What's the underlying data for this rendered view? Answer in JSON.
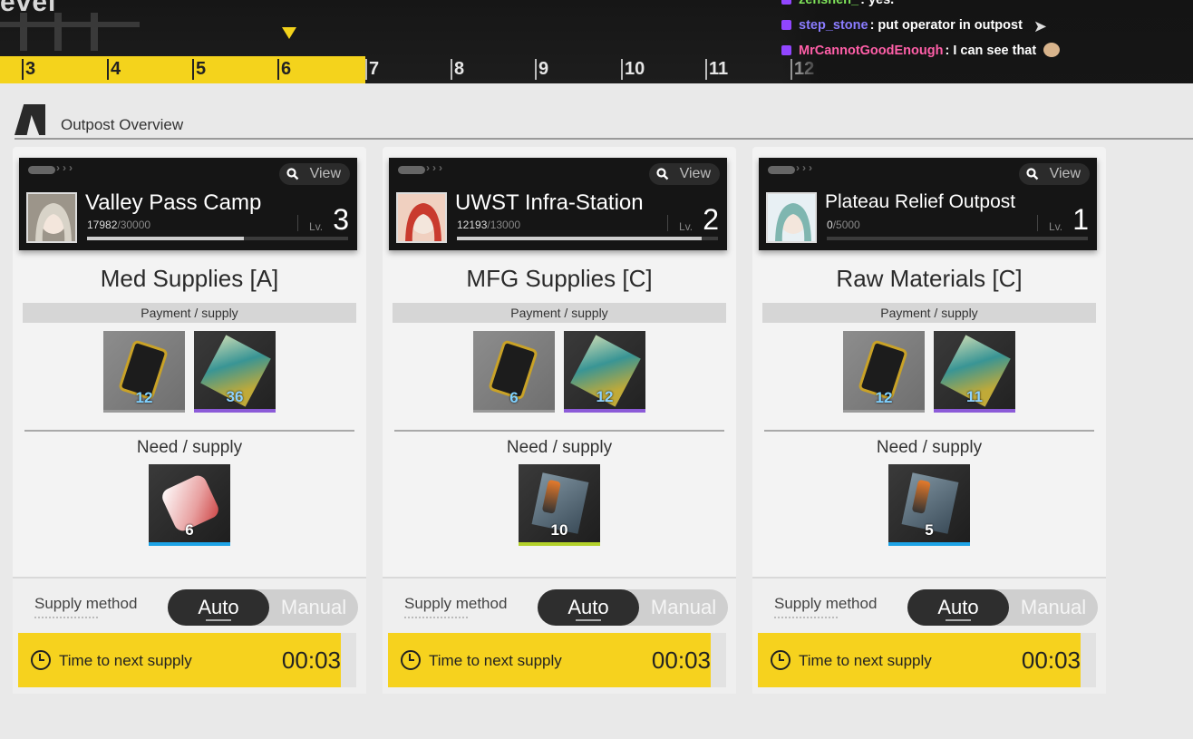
{
  "top": {
    "logo_text": "evel",
    "timeline": [
      {
        "num": "3",
        "done": true
      },
      {
        "num": "4",
        "done": true
      },
      {
        "num": "5",
        "done": true
      },
      {
        "num": "6",
        "done": true
      },
      {
        "num": "7",
        "done": false
      },
      {
        "num": "8",
        "done": false
      },
      {
        "num": "9",
        "done": false
      },
      {
        "num": "10",
        "done": false
      },
      {
        "num": "11",
        "done": false
      },
      {
        "num": "12",
        "done": false
      }
    ],
    "timeline_progress": 0.306
  },
  "chat": [
    {
      "user": "zenshen_",
      "message": ": yes.",
      "user_color": "#7fe35a"
    },
    {
      "user": "step_stone",
      "message": ": put operator in outpost",
      "user_color": "#8a7cff"
    },
    {
      "user": "MrCannotGoodEnough",
      "message": ": I can see that",
      "user_color": "#ff5fa8"
    }
  ],
  "section": {
    "title": "Outpost Overview"
  },
  "common": {
    "view_label": "View",
    "lv_label": "Lv.",
    "payment_label": "Payment / supply",
    "need_label": "Need / supply",
    "supply_method_label": "Supply method",
    "auto_label": "Auto",
    "manual_label": "Manual",
    "timer_label": "Time to next supply"
  },
  "outposts": [
    {
      "name": "Valley Pass Camp",
      "progress_current": "17982",
      "progress_max": "/30000",
      "progress_fraction": 0.599,
      "level": "3",
      "supply_type": "Med Supplies [A]",
      "payment": [
        {
          "qty": "12",
          "icon": "phone-icon"
        },
        {
          "qty": "36",
          "icon": "chip-icon"
        }
      ],
      "need": [
        {
          "qty": "6",
          "icon": "medpack-icon"
        }
      ],
      "timer": "00:03",
      "timer_fraction": 0.955
    },
    {
      "name": "UWST Infra-Station",
      "progress_current": "12193",
      "progress_max": "/13000",
      "progress_fraction": 0.938,
      "level": "2",
      "supply_type": "MFG Supplies [C]",
      "payment": [
        {
          "qty": "6",
          "icon": "phone-icon"
        },
        {
          "qty": "12",
          "icon": "chip-icon"
        }
      ],
      "need": [
        {
          "qty": "10",
          "icon": "battery-icon"
        }
      ],
      "timer": "00:03",
      "timer_fraction": 0.955
    },
    {
      "name": "Plateau Relief Outpost",
      "progress_current": "0",
      "progress_max": "/5000",
      "progress_fraction": 0,
      "level": "1",
      "supply_type": "Raw Materials [C]",
      "payment": [
        {
          "qty": "12",
          "icon": "phone-icon"
        },
        {
          "qty": "11",
          "icon": "chip-icon"
        }
      ],
      "need": [
        {
          "qty": "5",
          "icon": "battery-icon"
        }
      ],
      "timer": "00:03",
      "timer_fraction": 0.955
    }
  ]
}
